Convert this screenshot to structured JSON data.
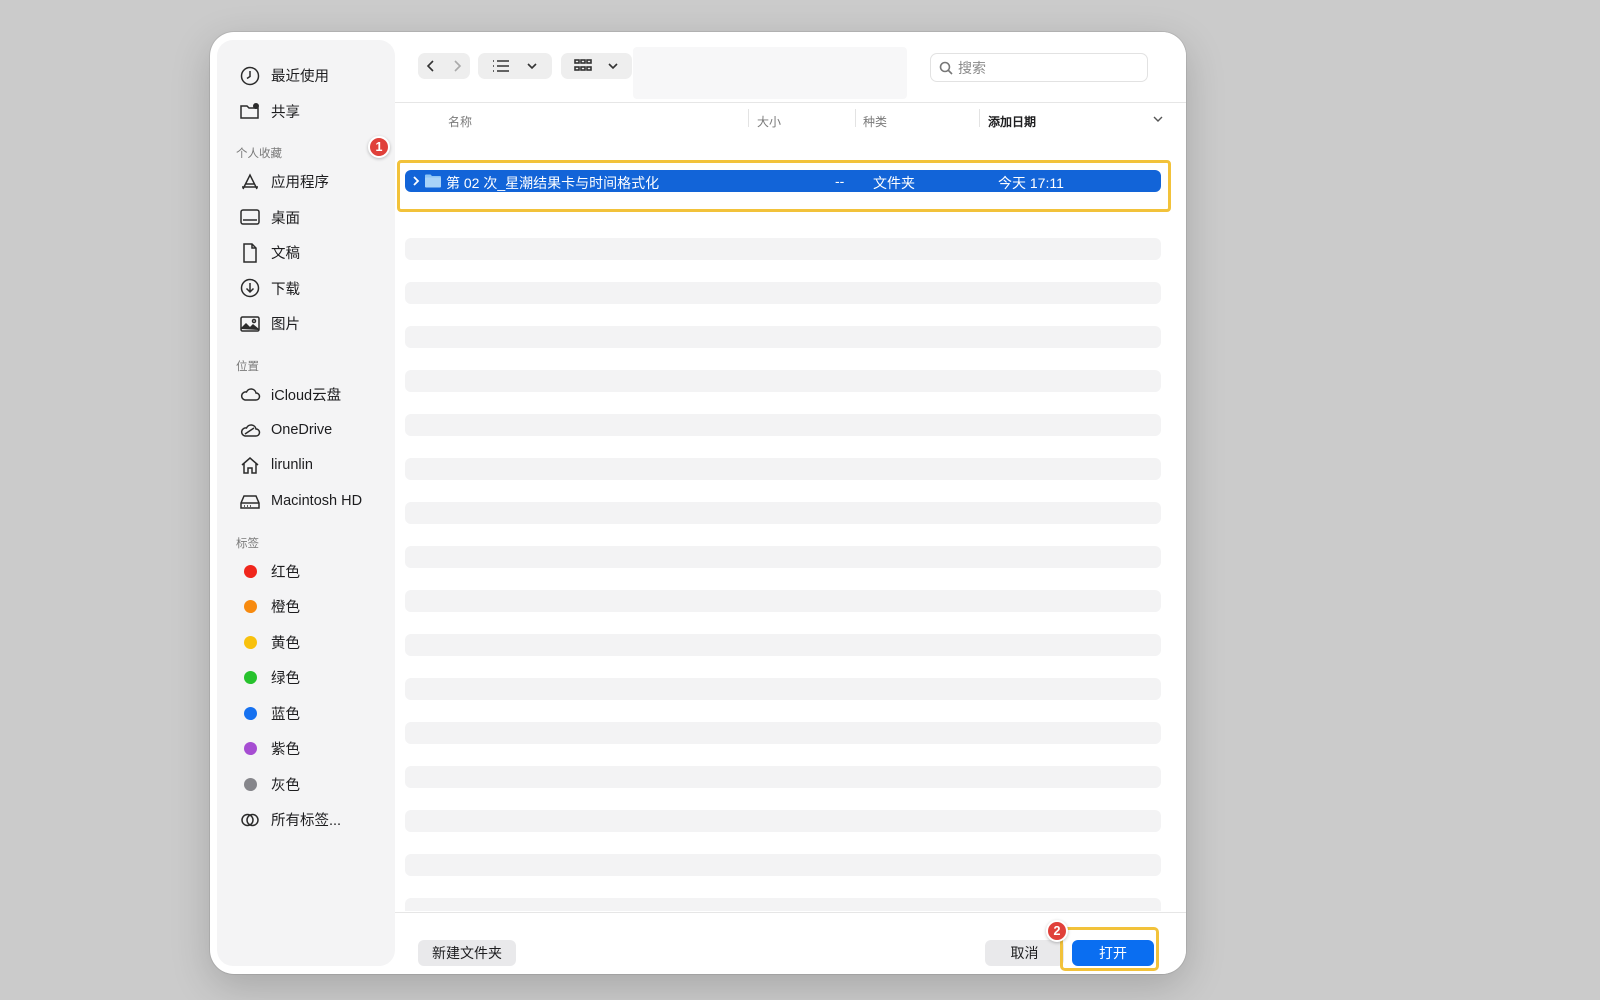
{
  "sidebar": {
    "top_items": [
      {
        "label": "最近使用",
        "icon": "clock-icon"
      },
      {
        "label": "共享",
        "icon": "shared-folder-icon"
      }
    ],
    "favorites_title": "个人收藏",
    "favorites": [
      {
        "label": "应用程序",
        "icon": "apps-icon"
      },
      {
        "label": "桌面",
        "icon": "desktop-icon"
      },
      {
        "label": "文稿",
        "icon": "document-icon"
      },
      {
        "label": "下载",
        "icon": "download-icon"
      },
      {
        "label": "图片",
        "icon": "picture-icon"
      }
    ],
    "locations_title": "位置",
    "locations": [
      {
        "label": "iCloud云盘",
        "icon": "cloud-icon"
      },
      {
        "label": "OneDrive",
        "icon": "onedrive-icon"
      },
      {
        "label": "lirunlin",
        "icon": "home-icon"
      },
      {
        "label": "Macintosh HD",
        "icon": "disk-icon"
      }
    ],
    "tags_title": "标签",
    "tags": [
      {
        "label": "红色",
        "color": "#f0261c"
      },
      {
        "label": "橙色",
        "color": "#f78a0f"
      },
      {
        "label": "黄色",
        "color": "#f8c10d"
      },
      {
        "label": "绿色",
        "color": "#27c22d"
      },
      {
        "label": "蓝色",
        "color": "#1671f0"
      },
      {
        "label": "紫色",
        "color": "#a64dd2"
      },
      {
        "label": "灰色",
        "color": "#86868b"
      }
    ],
    "all_tags": "所有标签..."
  },
  "toolbar": {
    "search_placeholder": "搜索"
  },
  "columns": {
    "name": "名称",
    "size": "大小",
    "kind": "种类",
    "date_added": "添加日期"
  },
  "files": [
    {
      "name": "第 02 次_星潮结果卡与时间格式化",
      "size": "--",
      "kind": "文件夹",
      "date_added": "今天 17:11"
    }
  ],
  "buttons": {
    "new_folder": "新建文件夹",
    "cancel": "取消",
    "open": "打开"
  },
  "annotations": {
    "badge_1": "1",
    "badge_2": "2"
  },
  "colors": {
    "accent": "#0a6ef1",
    "selection": "#1264d8",
    "highlight": "#f2c23a",
    "badge": "#e0403a"
  }
}
